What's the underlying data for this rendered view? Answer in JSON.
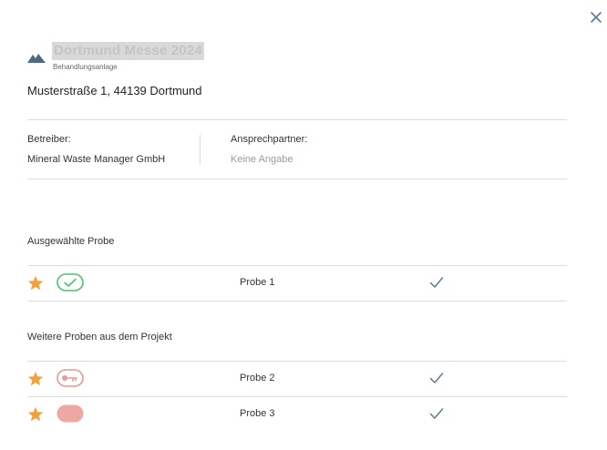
{
  "dialog": {
    "title": "Dortmund Messe 2024",
    "subtitle": "Behandlungsanlage",
    "address": "Musterstraße 1, 44139 Dortmund"
  },
  "info": {
    "operator_label": "Betreiber:",
    "operator_value": "Mineral Waste Manager GmbH",
    "contact_label": "Ansprechpartner:",
    "contact_value": "Keine Angabe"
  },
  "selected_section": {
    "title": "Ausgewählte Probe",
    "samples": [
      {
        "name": "Probe 1",
        "badge_icon": "check-badge-icon",
        "badge_color": "#4cc46a"
      }
    ]
  },
  "other_section": {
    "title": "Weitere Proben aus dem Projekt",
    "samples": [
      {
        "name": "Probe 2",
        "badge_icon": "key-badge-icon",
        "badge_color": "#e69a94"
      },
      {
        "name": "Probe 3",
        "badge_icon": "filled-badge-icon",
        "badge_color": "#eea8a2"
      }
    ]
  },
  "colors": {
    "star": "#f0a33c",
    "check": "#5d7a94",
    "icon": "#4f6b82"
  }
}
